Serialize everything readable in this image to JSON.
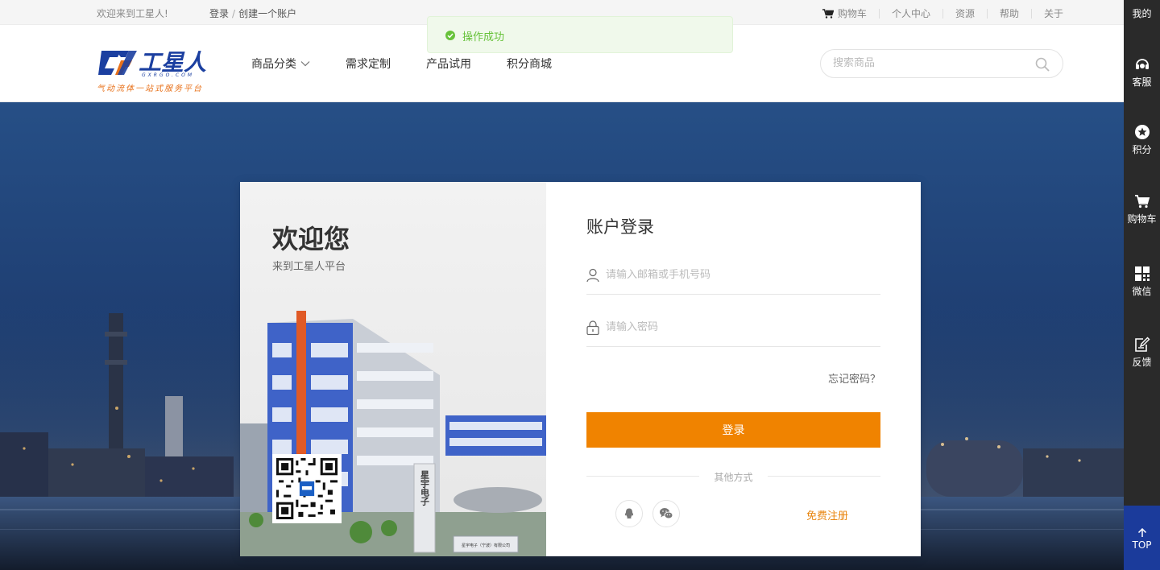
{
  "topbar": {
    "welcome": "欢迎来到工星人!",
    "login": "登录",
    "sep": "/",
    "create_account": "创建一个账户",
    "cart": "购物车",
    "personal_center": "个人中心",
    "resources": "资源",
    "help": "帮助",
    "about": "关于"
  },
  "header": {
    "logo_text": "工星人",
    "logo_url_text": "GXRGO.COM",
    "slogan": "气动流体一站式服务平台",
    "nav": [
      "商品分类",
      "需求定制",
      "产品试用",
      "积分商城"
    ],
    "search_placeholder": "搜索商品"
  },
  "toast": {
    "message": "操作成功",
    "color": "#67c23a"
  },
  "card": {
    "welcome_title": "欢迎您",
    "welcome_subtitle": "来到工星人平台",
    "login_title": "账户登录",
    "username_placeholder": "请输入邮箱或手机号码",
    "password_placeholder": "请输入密码",
    "forgot": "忘记密码？",
    "login_button": "登录",
    "other_methods": "其他方式",
    "register": "免费注册",
    "building_sign": "星宇电子",
    "building_plaque": "星宇电子（宁波）有限公司"
  },
  "sidebar": {
    "items": [
      "我的",
      "客服",
      "积分",
      "购物车",
      "微信",
      "反馈"
    ],
    "top": "TOP"
  },
  "colors": {
    "accent": "#f08300",
    "sidebar": "#2a2a2a",
    "top_button": "#1b3b9b",
    "logo_blue": "#1b3fa0",
    "logo_orange": "#e8711a"
  }
}
